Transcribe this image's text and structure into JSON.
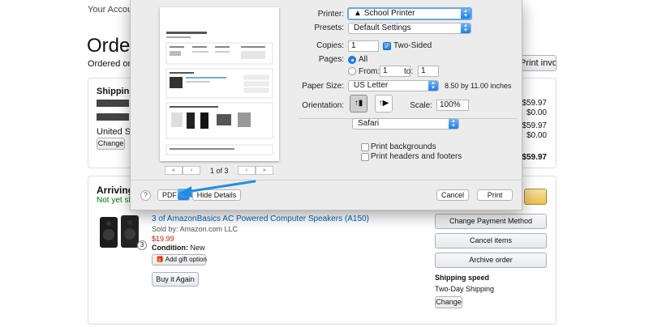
{
  "background": {
    "account_link": "Your Account",
    "order_title": "Order D",
    "ordered_on": "Ordered on Ja",
    "print_invoice": "Print invoice",
    "shipping_address_label": "Shipping A",
    "united_states": "United State",
    "change_label": "Change",
    "summary": [
      "$59.97",
      "$0.00",
      "$59.97",
      "$0.00",
      "$59.97"
    ],
    "arriving": "Arriving",
    "not_shipped": "Not yet shipp",
    "quantity": "3",
    "product_title": "3 of AmazonBasics AC Powered Computer Speakers (A150)",
    "sold_by": "Sold by: Amazon.com LLC",
    "price": "$19.99",
    "condition_label": "Condition:",
    "condition_value": "New",
    "add_gift_option": "Add gift option",
    "buy_again": "Buy it Again",
    "change_payment_method": "Change Payment Method",
    "cancel_items": "Cancel items",
    "archive_order": "Archive order",
    "shipping_speed_label": "Shipping speed",
    "shipping_speed_value": "Two-Day Shipping",
    "shipping_change": "Change"
  },
  "dialog": {
    "printer_label": "Printer:",
    "printer_value": "School Printer",
    "presets_label": "Presets:",
    "presets_value": "Default Settings",
    "copies_label": "Copies:",
    "copies_value": "1",
    "two_sided_label": "Two-Sided",
    "pages_label": "Pages:",
    "pages_all": "All",
    "pages_from": "From:",
    "pages_from_value": "1",
    "pages_to": "to:",
    "pages_to_value": "1",
    "paper_size_label": "Paper Size:",
    "paper_size_value": "US Letter",
    "paper_dimensions": "8.50 by 11.00 inches",
    "orientation_label": "Orientation:",
    "scale_label": "Scale:",
    "scale_value": "100%",
    "app_section": "Safari",
    "print_backgrounds": "Print backgrounds",
    "print_headers_footers": "Print headers and footers",
    "page_counter": "1 of 3",
    "pdf_label": "PDF",
    "hide_details": "Hide Details",
    "cancel": "Cancel",
    "print": "Print",
    "help": "?"
  },
  "colors": {
    "accent_blue": "#1a7ff2",
    "link_blue": "#0066c0",
    "price_red": "#b12704",
    "annotation_arrow": "#1e8fe0"
  },
  "icons": [
    "warning-triangle-icon",
    "portrait-icon",
    "landscape-icon",
    "chevron-updown-icon",
    "help-icon",
    "checkmark-icon"
  ]
}
